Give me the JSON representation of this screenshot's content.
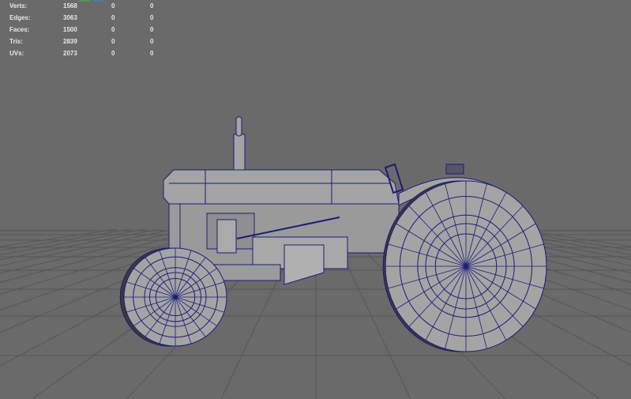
{
  "hud": {
    "rows": [
      {
        "label": "Verts:",
        "total": "1568",
        "selected": "0",
        "highlighted": "0"
      },
      {
        "label": "Edges:",
        "total": "3063",
        "selected": "0",
        "highlighted": "0"
      },
      {
        "label": "Faces:",
        "total": "1500",
        "selected": "0",
        "highlighted": "0"
      },
      {
        "label": "Tris:",
        "total": "2839",
        "selected": "0",
        "highlighted": "0"
      },
      {
        "label": "UVs:",
        "total": "2073",
        "selected": "0",
        "highlighted": "0"
      }
    ]
  },
  "colors": {
    "background": "#6a6a6a",
    "grid": "#575757",
    "mesh_fill": "#a4a4a4",
    "wire": "#1c1c78"
  }
}
